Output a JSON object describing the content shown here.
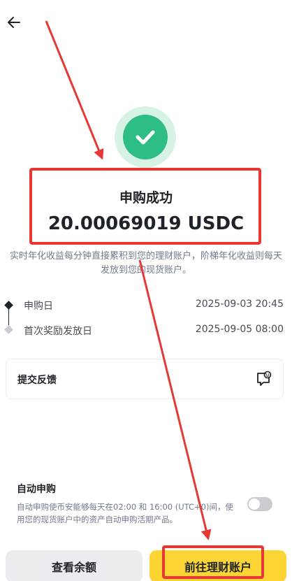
{
  "header": {
    "back_icon": "arrow-left-icon"
  },
  "result": {
    "icon": "check-circle-icon",
    "title": "申购成功",
    "amount": "20.00069019 USDC",
    "description": "实时年化收益每分钟直接累积到您的理财账户，阶梯年化收益则每天发放到您的现货账户。"
  },
  "timeline": [
    {
      "label": "申购日",
      "value": "2025-09-03 20:45"
    },
    {
      "label": "首次奖励发放日",
      "value": "2025-09-05 08:00"
    }
  ],
  "feedback": {
    "label": "提交反馈",
    "icon": "feedback-smile-icon"
  },
  "auto_subscribe": {
    "title": "自动申购",
    "description": "自动申购使币安能够每天在02:00 和 16:00 (UTC+0)间，使用您的现货账户中的资产自动申购活期产品。",
    "enabled": false
  },
  "buttons": {
    "view_balance": "查看余额",
    "go_to_earn": "前往理财账户"
  },
  "colors": {
    "success": "#2ebd85",
    "primary": "#fcd535",
    "annotation": "#e53935"
  }
}
